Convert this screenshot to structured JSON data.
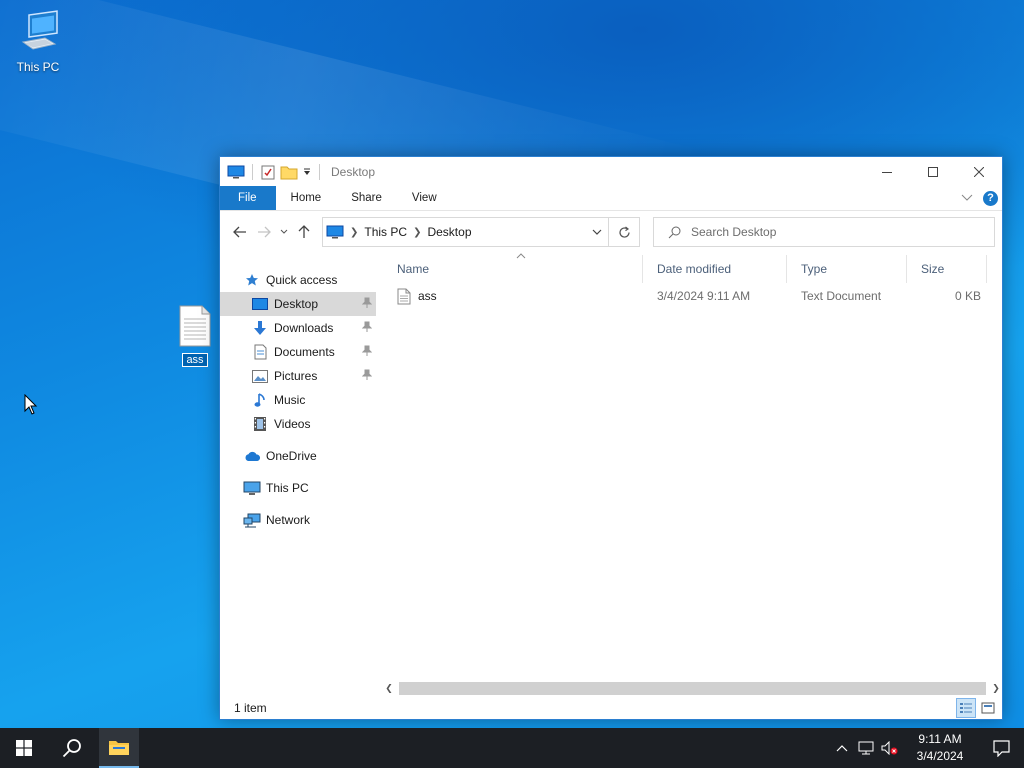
{
  "desktop": {
    "icons": [
      {
        "label": "This PC",
        "icon": "computer-icon"
      }
    ],
    "dragged_file": {
      "label": "ass",
      "icon": "text-file-icon"
    }
  },
  "window": {
    "title": "Desktop",
    "controls": [
      "minimize",
      "maximize",
      "close"
    ],
    "ribbon": {
      "tabs": [
        "File",
        "Home",
        "Share",
        "View"
      ],
      "help": "?"
    },
    "address": {
      "crumbs": [
        "This PC",
        "Desktop"
      ]
    },
    "search": {
      "placeholder": "Search Desktop",
      "value": ""
    },
    "sidebar": {
      "quick_access": "Quick access",
      "pinned": [
        "Desktop",
        "Downloads",
        "Documents",
        "Pictures"
      ],
      "items": [
        "Music",
        "Videos"
      ],
      "onedrive": "OneDrive",
      "this_pc": "This PC",
      "network": "Network"
    },
    "columns": [
      "Name",
      "Date modified",
      "Type",
      "Size"
    ],
    "files": [
      {
        "name": "ass",
        "modified": "3/4/2024 9:11 AM",
        "type": "Text Document",
        "size": "0 KB"
      }
    ],
    "status": "1 item"
  },
  "taskbar": {
    "time": "9:11 AM",
    "date": "3/4/2024"
  },
  "colors": {
    "accent": "#1979ca",
    "selected": "#d9d9d9",
    "taskbar": "#1c1f24"
  }
}
